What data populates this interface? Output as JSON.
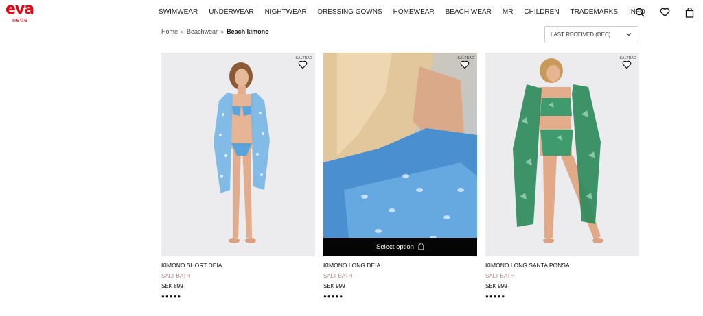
{
  "logo": {
    "main": "eva",
    "sub": "nette"
  },
  "nav": {
    "items": [
      "SWIMWEAR",
      "UNDERWEAR",
      "NIGHTWEAR",
      "DRESSING GOWNS",
      "HOMEWEAR",
      "BEACH WEAR",
      "MR",
      "CHILDREN",
      "TRADEMARKS",
      "INFO"
    ]
  },
  "header_icons": [
    "search-icon",
    "heart-icon",
    "bag-icon"
  ],
  "breadcrumb": {
    "home": "Home",
    "section": "Beachwear",
    "current": "Beach kimono",
    "separator": "»"
  },
  "sort": {
    "selected": "LAST RECEIVED (DEC)"
  },
  "products": [
    {
      "name": "KIMONO SHORT DEIA",
      "brand": "SALT BATH",
      "price": "SEK 899",
      "stars": "●●●●●",
      "badge": "SALTBAD"
    },
    {
      "name": "KIMONO LONG DEIA",
      "brand": "SALT BATH",
      "price": "SEK 999",
      "stars": "●●●●●",
      "badge": "SALTBAD",
      "select_label": "Select option"
    },
    {
      "name": "KIMONO LONG SANTA PONSA",
      "brand": "SALT BATH",
      "price": "SEK 999",
      "stars": "●●●●●",
      "badge": "SALTBAD"
    }
  ],
  "colors": {
    "brand": "#e30613",
    "select_bar": "#050505"
  }
}
